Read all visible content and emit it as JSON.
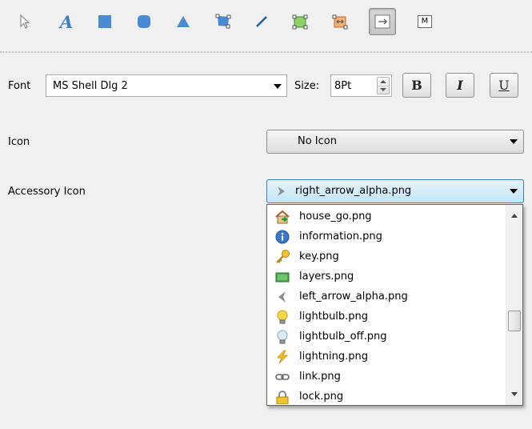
{
  "toolbar": {
    "tools": [
      {
        "icon": "pointer-arrow-icon"
      },
      {
        "icon": "text-tool-icon",
        "glyph": "A"
      },
      {
        "icon": "rectangle-tool-icon"
      },
      {
        "icon": "rounded-rectangle-tool-icon"
      },
      {
        "icon": "triangle-tool-icon"
      },
      {
        "icon": "polygon-tool-icon"
      },
      {
        "icon": "line-tool-icon"
      },
      {
        "icon": "select-region-icon"
      },
      {
        "icon": "resize-handles-icon"
      },
      {
        "icon": "fit-width-icon",
        "active": true
      },
      {
        "icon": "m-tool-icon",
        "glyph": "M"
      }
    ]
  },
  "font_row": {
    "label": "Font",
    "font_value": "MS Shell Dlg 2",
    "size_label": "Size:",
    "size_value": "8Pt",
    "bold_label": "B",
    "italic_label": "I",
    "underline_label": "U"
  },
  "icon_row": {
    "label": "Icon",
    "value": "No Icon"
  },
  "accessory_row": {
    "label": "Accessory Icon",
    "value": "right_arrow_alpha.png",
    "value_icon": "right-arrow-icon"
  },
  "dropdown": {
    "items": [
      {
        "label": "house_go.png",
        "icon": "house-go-icon"
      },
      {
        "label": "information.png",
        "icon": "information-icon"
      },
      {
        "label": "key.png",
        "icon": "key-icon"
      },
      {
        "label": "layers.png",
        "icon": "layers-icon"
      },
      {
        "label": "left_arrow_alpha.png",
        "icon": "left-arrow-icon"
      },
      {
        "label": "lightbulb.png",
        "icon": "lightbulb-icon"
      },
      {
        "label": "lightbulb_off.png",
        "icon": "lightbulb-off-icon"
      },
      {
        "label": "lightning.png",
        "icon": "lightning-icon"
      },
      {
        "label": "link.png",
        "icon": "link-icon"
      },
      {
        "label": "lock.png",
        "icon": "lock-icon"
      }
    ],
    "scroll_position": 0.5
  },
  "colors": {
    "accent_blue": "#3e7fc4",
    "selected_combo_border": "#3c7fb1"
  }
}
